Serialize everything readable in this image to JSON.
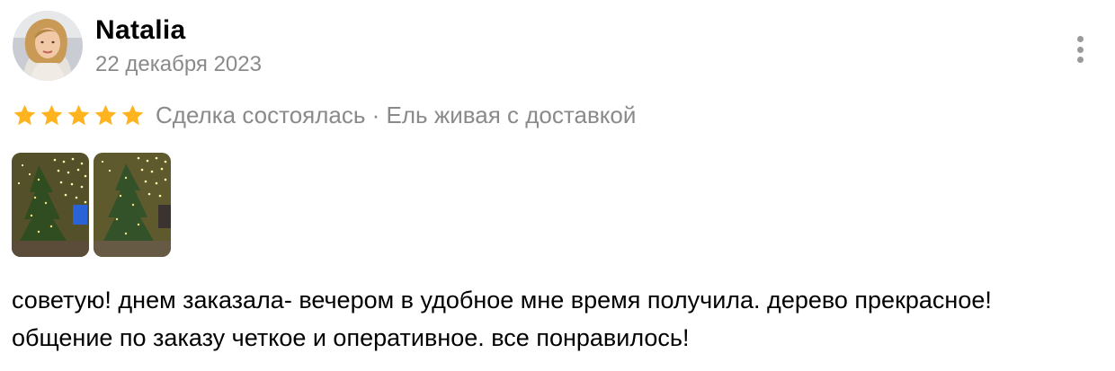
{
  "review": {
    "author": "Natalia",
    "date": "22 декабря 2023",
    "rating": 5,
    "rating_max": 5,
    "meta": "Сделка состоялась · Ель живая с доставкой",
    "photos": [
      {
        "name": "review-photo-1"
      },
      {
        "name": "review-photo-2"
      }
    ],
    "text_lines": [
      "советую! днем заказала- вечером в удобное мне время получила. дерево прекрасное!",
      "общение по заказу четкое и оперативное. все понравилось!"
    ]
  },
  "colors": {
    "star": "#ffb41f",
    "secondary_text": "#8a8a8a",
    "menu_dots": "#9a9a9a"
  },
  "icons": {
    "menu": "more-vertical-icon",
    "star": "star-icon"
  }
}
